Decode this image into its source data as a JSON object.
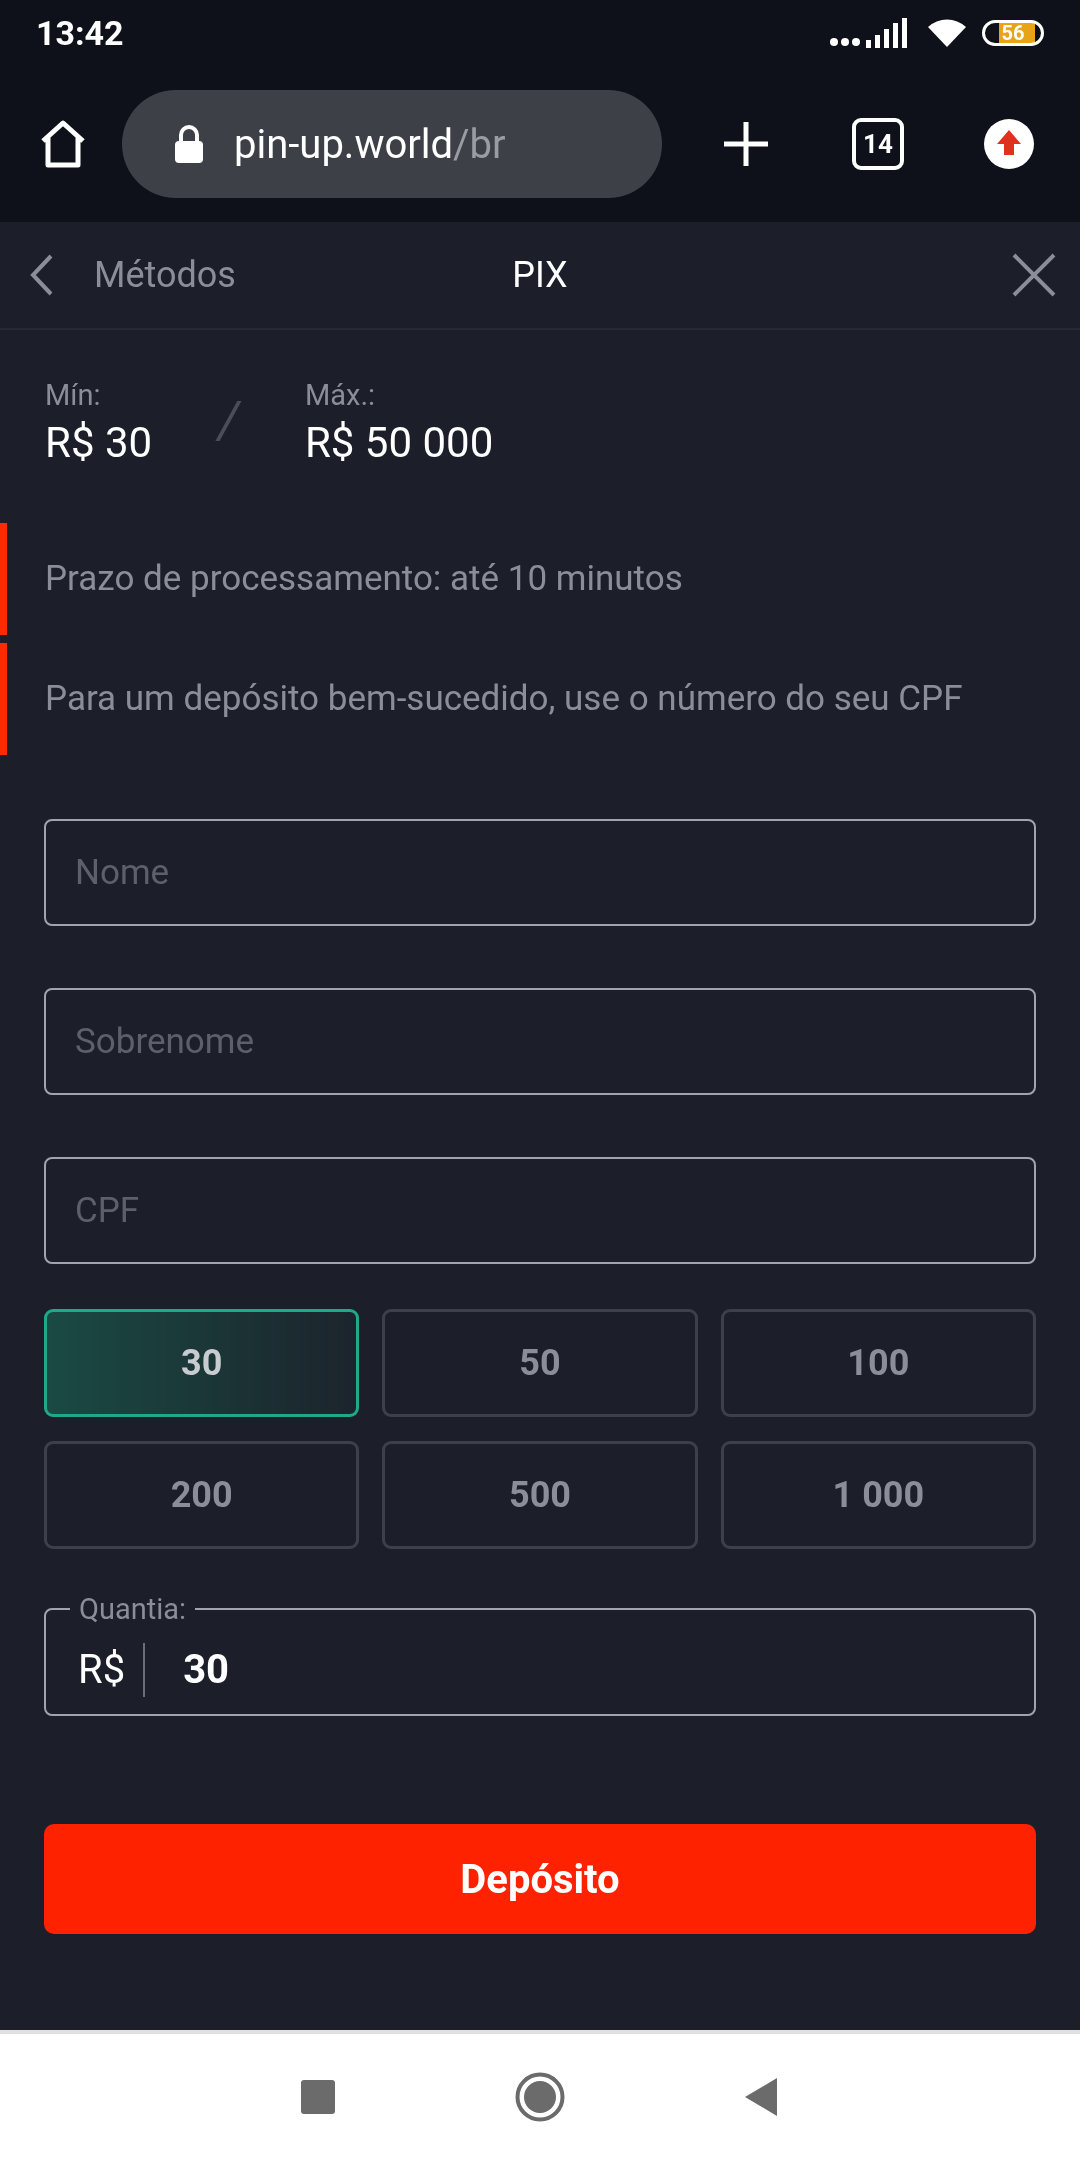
{
  "status_bar": {
    "time": "13:42",
    "battery": "56"
  },
  "browser": {
    "url_host": "pin-up.world",
    "url_path": "/br",
    "tab_count": "14"
  },
  "header": {
    "back_label": "Métodos",
    "title": "PIX"
  },
  "limits": [
    {
      "label": "Mín:",
      "value": "R$ 30"
    },
    {
      "label": "Máx.:",
      "value": "R$ 50 000"
    }
  ],
  "limits_separator": "/",
  "notices": [
    "Prazo de processamento: até 10 minutos",
    "Para um depósito bem-sucedido, use o número do seu CPF"
  ],
  "fields": [
    {
      "placeholder": "Nome"
    },
    {
      "placeholder": "Sobrenome"
    },
    {
      "placeholder": "CPF"
    }
  ],
  "amount_options": [
    {
      "label": "30",
      "selected": true
    },
    {
      "label": "50",
      "selected": false
    },
    {
      "label": "100",
      "selected": false
    },
    {
      "label": "200",
      "selected": false
    },
    {
      "label": "500",
      "selected": false
    },
    {
      "label": "1 000",
      "selected": false
    }
  ],
  "amount_field": {
    "label": "Quantia:",
    "currency": "R$",
    "value": "30"
  },
  "submit_button": "Depósito"
}
